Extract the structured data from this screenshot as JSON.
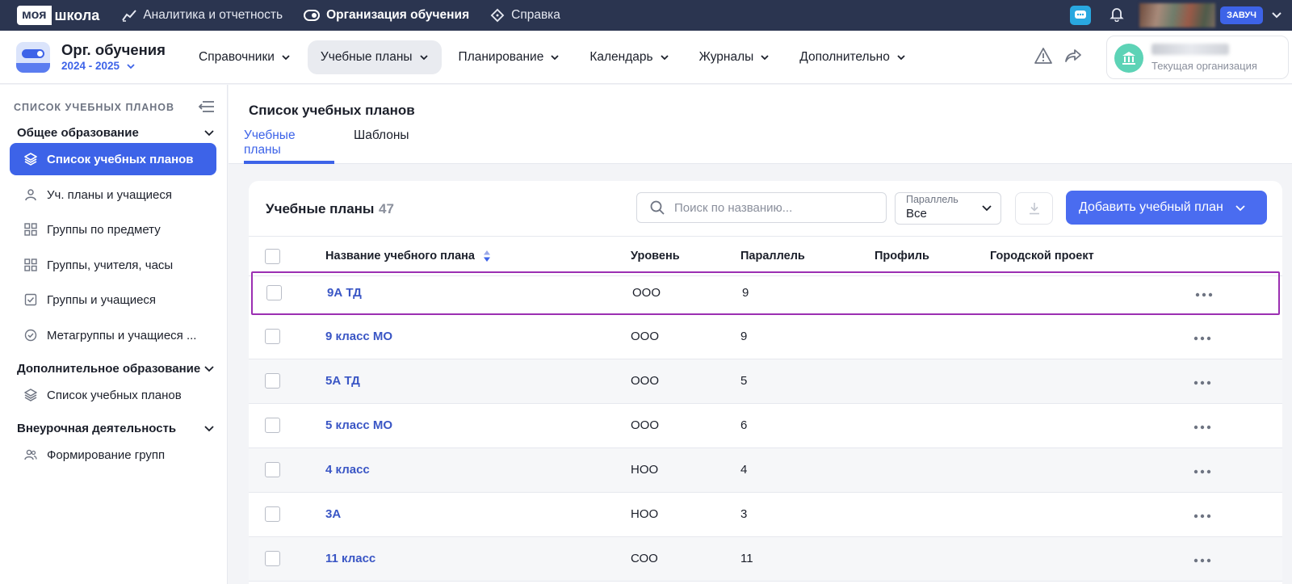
{
  "brand": {
    "part1": "моя",
    "part2": "школа"
  },
  "topnav": [
    {
      "label": "Аналитика и отчетность",
      "icon": "chart-line-icon"
    },
    {
      "label": "Организация обучения",
      "icon": "toggle-icon"
    },
    {
      "label": "Справка",
      "icon": "diamond-help-icon"
    }
  ],
  "user": {
    "role": "ЗАВУЧ"
  },
  "app": {
    "title": "Орг. обучения",
    "year": "2024 - 2025"
  },
  "mainnav": [
    {
      "label": "Справочники"
    },
    {
      "label": "Учебные планы"
    },
    {
      "label": "Планирование"
    },
    {
      "label": "Календарь"
    },
    {
      "label": "Журналы"
    },
    {
      "label": "Дополнительно"
    }
  ],
  "org": {
    "label": "Текущая организация"
  },
  "sidebar": {
    "heading": "СПИСОК УЧЕБНЫХ ПЛАНОВ",
    "sections": [
      {
        "title": "Общее образование"
      },
      {
        "title": "Дополнительное образование"
      },
      {
        "title": "Внеурочная деятельность"
      }
    ],
    "items": [
      {
        "label": "Список учебных планов"
      },
      {
        "label": "Уч. планы и учащиеся"
      },
      {
        "label": "Группы по предмету"
      },
      {
        "label": "Группы, учителя, часы"
      },
      {
        "label": "Группы и учащиеся"
      },
      {
        "label": "Метагруппы и учащиеся ..."
      },
      {
        "label": "Список учебных планов"
      },
      {
        "label": "Формирование групп"
      }
    ]
  },
  "page": {
    "title": "Список учебных планов",
    "tabs": [
      {
        "label": "Учебные планы"
      },
      {
        "label": "Шаблоны"
      }
    ]
  },
  "card": {
    "title": "Учебные планы",
    "count": "47",
    "search_placeholder": "Поиск по названию...",
    "filter": {
      "label": "Параллель",
      "value": "Все"
    },
    "add_label": "Добавить учебный план"
  },
  "table": {
    "columns": [
      "Название учебного плана",
      "Уровень",
      "Параллель",
      "Профиль",
      "Городской проект"
    ],
    "rows": [
      {
        "name": "9А ТД",
        "level": "ООО",
        "parallel": "9"
      },
      {
        "name": "9 класс МО",
        "level": "ООО",
        "parallel": "9"
      },
      {
        "name": "5А ТД",
        "level": "ООО",
        "parallel": "5"
      },
      {
        "name": "5 класс МО",
        "level": "ООО",
        "parallel": "6"
      },
      {
        "name": "4 класс",
        "level": "НОО",
        "parallel": "4"
      },
      {
        "name": "3А",
        "level": "НОО",
        "parallel": "3"
      },
      {
        "name": "11 класс",
        "level": "СОО",
        "parallel": "11"
      }
    ]
  },
  "colors": {
    "accent": "#3d63e8",
    "topbar": "#2b3550",
    "highlight": "#9b2fb2",
    "link": "#3a56c5"
  }
}
